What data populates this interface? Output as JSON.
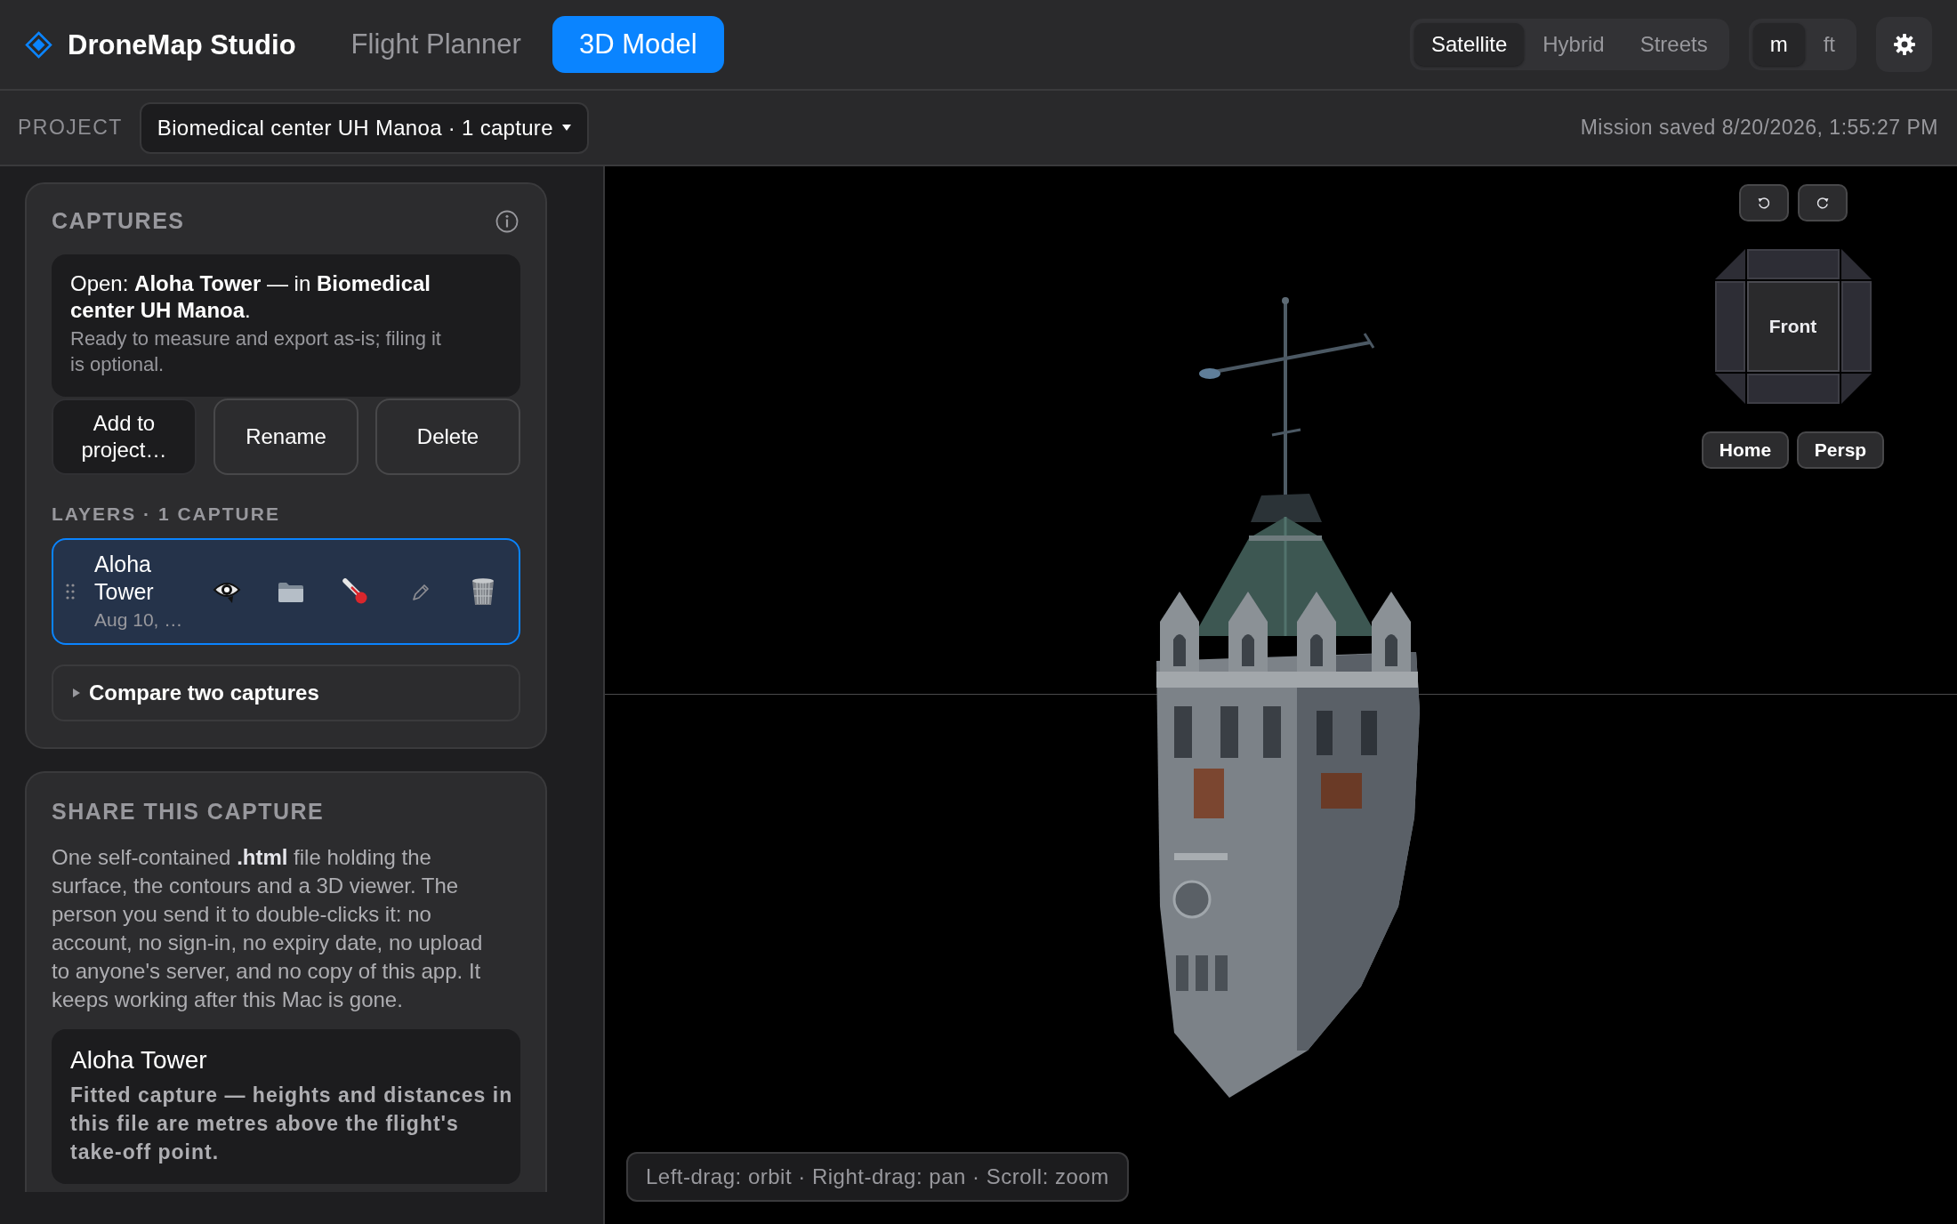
{
  "app": {
    "name": "DroneMap Studio"
  },
  "nav_tabs": [
    {
      "label": "Flight Planner",
      "selected": false
    },
    {
      "label": "3D Model",
      "selected": true
    }
  ],
  "basemap_options": [
    {
      "label": "Satellite",
      "selected": true
    },
    {
      "label": "Hybrid",
      "selected": false
    },
    {
      "label": "Streets",
      "selected": false
    }
  ],
  "units": [
    {
      "label": "m",
      "selected": true
    },
    {
      "label": "ft",
      "selected": false
    }
  ],
  "project_bar": {
    "label": "PROJECT",
    "project": "Biomedical center UH Manoa · 1 capture",
    "save_status": "Mission saved 8/20/2026, 1:55:27 PM"
  },
  "captures_panel": {
    "title": "CAPTURES",
    "notice": {
      "headline": "Open: **Aloha Tower** — in **Biomedical center UH Manoa**.",
      "detail": "Ready to measure and export as-is; filing it is optional."
    },
    "actions": [
      {
        "label": "Add to project…",
        "kind": "filled"
      },
      {
        "label": "Rename",
        "kind": "outline"
      },
      {
        "label": "Delete",
        "kind": "outline"
      }
    ],
    "layers_heading": "LAYERS · 1 CAPTURE",
    "layers": [
      {
        "name": "Aloha Tower",
        "date": "Aug 10, …",
        "selected": true
      }
    ],
    "compare": {
      "label": "Compare two captures",
      "expanded": false
    }
  },
  "share_panel": {
    "title": "SHARE THIS CAPTURE",
    "description": "One self-contained **.html** file holding the surface, the contours and a 3D viewer. The person you send it to double-clicks it: no account, no sign-in, no expiry date, no upload to anyone's server, and no copy of this app. It keeps working after this Mac is gone.",
    "capture_card": {
      "title": "Aloha Tower",
      "description": "Fitted capture — heights and distances in this file are metres above the flight's take-off point."
    }
  },
  "viewport": {
    "view_cube": {
      "face": "Front"
    },
    "view_buttons": [
      {
        "label": "Home"
      },
      {
        "label": "Persp"
      }
    ],
    "hint": "Left-drag: orbit · Right-drag: pan · Scroll: zoom"
  }
}
